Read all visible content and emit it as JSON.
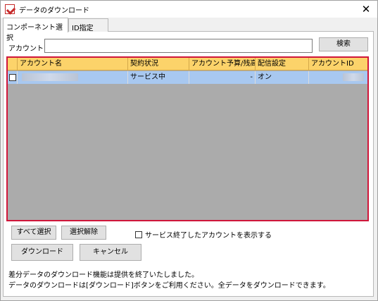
{
  "window": {
    "title": "データのダウンロード",
    "close_glyph": "✕"
  },
  "tabs": [
    {
      "label": "コンポーネント選択",
      "active": true
    },
    {
      "label": "ID指定",
      "active": false
    }
  ],
  "search": {
    "label": "アカウント",
    "value": "",
    "button_label": "検索"
  },
  "grid": {
    "columns": [
      "アカウント名",
      "契約状況",
      "アカウント予算/残高",
      "配信設定",
      "アカウントID"
    ],
    "rows": [
      {
        "checked": false,
        "account_name": "",
        "contract_status": "サービス中",
        "budget_balance": "-",
        "delivery_setting": "オン",
        "account_id": ""
      }
    ],
    "header_color": "#fcd36a",
    "selected_row_color": "#a8c8f0",
    "highlight_border_color": "#d0163a"
  },
  "actions": {
    "select_all_label": "すべて選択",
    "deselect_label": "選択解除",
    "show_ended_label": "サービス終了したアカウントを表示する",
    "show_ended_checked": false,
    "download_label": "ダウンロード",
    "cancel_label": "キャンセル"
  },
  "notices": [
    "差分データのダウンロード機能は提供を終了いたしました。",
    "データのダウンロードは[ダウンロード]ボタンをご利用ください。全データをダウンロードできます。"
  ]
}
